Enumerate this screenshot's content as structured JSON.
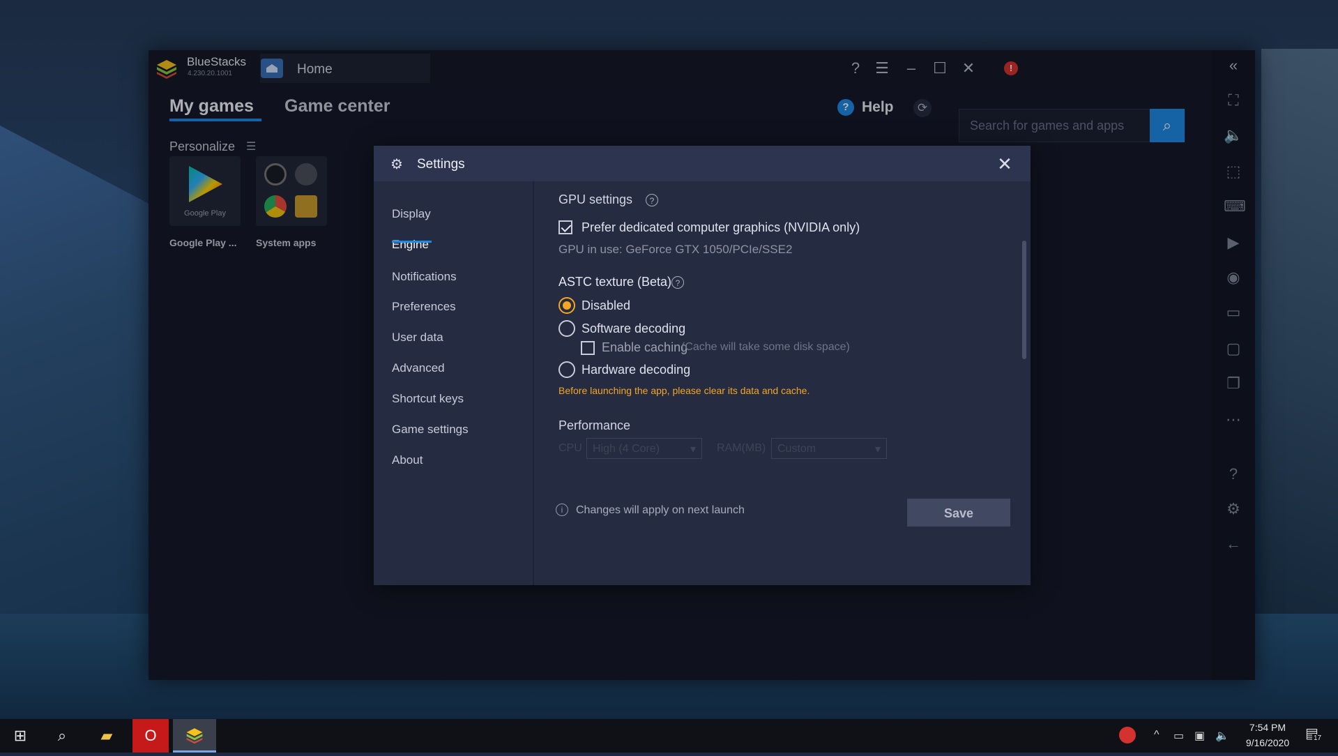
{
  "titlebar": {
    "brand": "BlueStacks",
    "version": "4.230.20.1001",
    "home_tab": "Home"
  },
  "main": {
    "tabs": [
      {
        "label": "My games",
        "active": true
      },
      {
        "label": "Game center",
        "active": false
      }
    ],
    "help_label": "Help",
    "search_placeholder": "Search for games and apps",
    "personalize_label": "Personalize",
    "apps": [
      {
        "label": "Google Play ...",
        "tile_text": "Google Play"
      },
      {
        "label": "System apps"
      }
    ]
  },
  "settings": {
    "title": "Settings",
    "nav": [
      {
        "label": "Display"
      },
      {
        "label": "Engine",
        "active": true
      },
      {
        "label": "Notifications"
      },
      {
        "label": "Preferences"
      },
      {
        "label": "User data"
      },
      {
        "label": "Advanced"
      },
      {
        "label": "Shortcut keys"
      },
      {
        "label": "Game settings"
      },
      {
        "label": "About"
      }
    ],
    "gpu": {
      "title": "GPU settings",
      "prefer_dedicated_label": "Prefer dedicated computer graphics (NVIDIA only)",
      "prefer_dedicated_checked": true,
      "gpu_in_use": "GPU in use: GeForce GTX 1050/PCIe/SSE2"
    },
    "astc": {
      "title": "ASTC texture (Beta)",
      "options": [
        {
          "label": "Disabled",
          "selected": true
        },
        {
          "label": "Software decoding",
          "selected": false
        },
        {
          "label": "Hardware decoding",
          "selected": false
        }
      ],
      "enable_caching_label": "Enable caching",
      "enable_caching_note": "(Cache will take some disk space)",
      "enable_caching_checked": false,
      "warning": "Before launching the app, please clear its data and cache."
    },
    "performance": {
      "title": "Performance",
      "cpu_label": "CPU",
      "cpu_value": "High (4 Core)",
      "ram_label": "RAM(MB)",
      "ram_value": "Custom"
    },
    "footer_note": "Changes will apply on next launch",
    "save_label": "Save"
  },
  "taskbar": {
    "time": "7:54 PM",
    "date": "9/16/2020",
    "notification_count": "17"
  },
  "colors": {
    "accent": "#1e88e5",
    "radio_selected": "#f5a623",
    "warning": "#f5a623",
    "dialog_bg": "#252b41",
    "header_bg": "#2d3450"
  }
}
